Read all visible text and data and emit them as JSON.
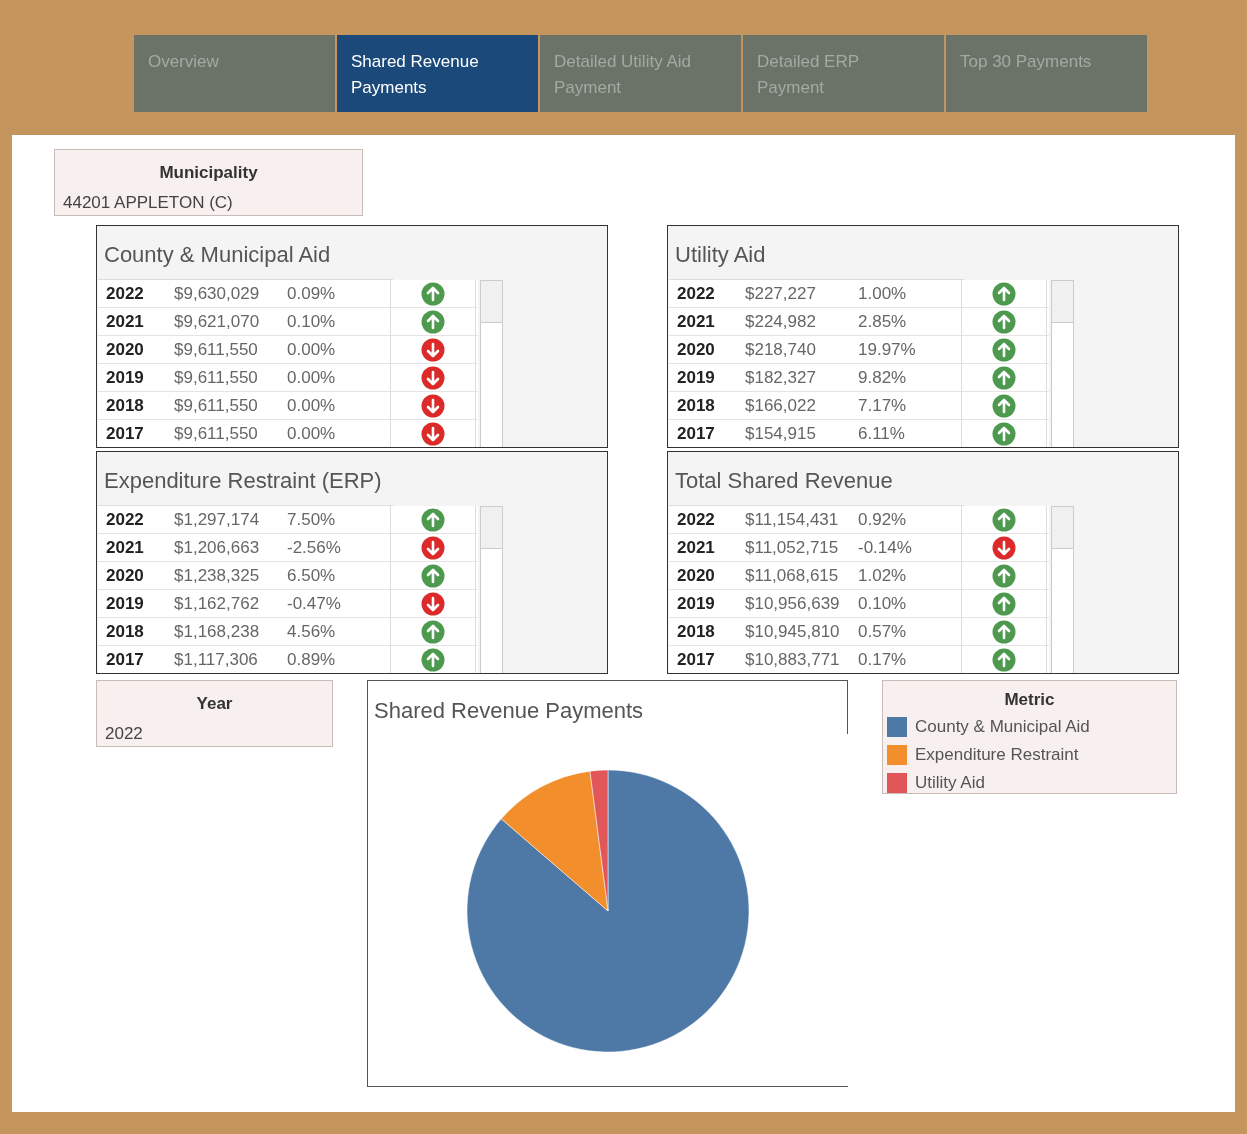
{
  "tabs": [
    {
      "label": "Overview",
      "selected": false
    },
    {
      "label": "Shared Revenue Payments",
      "selected": true
    },
    {
      "label": "Detailed Utility Aid Payment",
      "selected": false
    },
    {
      "label": "Detailed  ERP Payment",
      "selected": false
    },
    {
      "label": "Top 30 Payments",
      "selected": false
    }
  ],
  "municipality_filter": {
    "label": "Municipality",
    "value": "44201 APPLETON (C)"
  },
  "panels": [
    {
      "title": "County & Municipal Aid",
      "rows": [
        {
          "year": "2022",
          "amount": "$9,630,029",
          "change": "0.09%",
          "rising": true
        },
        {
          "year": "2021",
          "amount": "$9,621,070",
          "change": "0.10%",
          "rising": true
        },
        {
          "year": "2020",
          "amount": "$9,611,550",
          "change": "0.00%",
          "rising": false
        },
        {
          "year": "2019",
          "amount": "$9,611,550",
          "change": "0.00%",
          "rising": false
        },
        {
          "year": "2018",
          "amount": "$9,611,550",
          "change": "0.00%",
          "rising": false
        },
        {
          "year": "2017",
          "amount": "$9,611,550",
          "change": "0.00%",
          "rising": false
        }
      ]
    },
    {
      "title": "Utility Aid",
      "rows": [
        {
          "year": "2022",
          "amount": "$227,227",
          "change": "1.00%",
          "rising": true
        },
        {
          "year": "2021",
          "amount": "$224,982",
          "change": "2.85%",
          "rising": true
        },
        {
          "year": "2020",
          "amount": "$218,740",
          "change": "19.97%",
          "rising": true
        },
        {
          "year": "2019",
          "amount": "$182,327",
          "change": "9.82%",
          "rising": true
        },
        {
          "year": "2018",
          "amount": "$166,022",
          "change": "7.17%",
          "rising": true
        },
        {
          "year": "2017",
          "amount": "$154,915",
          "change": "6.11%",
          "rising": true
        }
      ]
    },
    {
      "title": "Expenditure Restraint (ERP)",
      "rows": [
        {
          "year": "2022",
          "amount": "$1,297,174",
          "change": "7.50%",
          "rising": true
        },
        {
          "year": "2021",
          "amount": "$1,206,663",
          "change": "-2.56%",
          "rising": false
        },
        {
          "year": "2020",
          "amount": "$1,238,325",
          "change": "6.50%",
          "rising": true
        },
        {
          "year": "2019",
          "amount": "$1,162,762",
          "change": "-0.47%",
          "rising": false
        },
        {
          "year": "2018",
          "amount": "$1,168,238",
          "change": "4.56%",
          "rising": true
        },
        {
          "year": "2017",
          "amount": "$1,117,306",
          "change": "0.89%",
          "rising": true
        }
      ]
    },
    {
      "title": "Total Shared Revenue",
      "rows": [
        {
          "year": "2022",
          "amount": "$11,154,431",
          "change": "0.92%",
          "rising": true
        },
        {
          "year": "2021",
          "amount": "$11,052,715",
          "change": "-0.14%",
          "rising": false
        },
        {
          "year": "2020",
          "amount": "$11,068,615",
          "change": "1.02%",
          "rising": true
        },
        {
          "year": "2019",
          "amount": "$10,956,639",
          "change": "0.10%",
          "rising": true
        },
        {
          "year": "2018",
          "amount": "$10,945,810",
          "change": "0.57%",
          "rising": true
        },
        {
          "year": "2017",
          "amount": "$10,883,771",
          "change": "0.17%",
          "rising": true
        }
      ]
    }
  ],
  "year_filter": {
    "label": "Year",
    "value": "2022"
  },
  "chart": {
    "title": "Shared Revenue Payments"
  },
  "legend": {
    "title": "Metric",
    "items": [
      {
        "label": "County & Municipal Aid",
        "color": "#4e79a7"
      },
      {
        "label": "Expenditure Restraint",
        "color": "#f28e2b"
      },
      {
        "label": "Utility Aid",
        "color": "#e15759"
      }
    ]
  }
}
